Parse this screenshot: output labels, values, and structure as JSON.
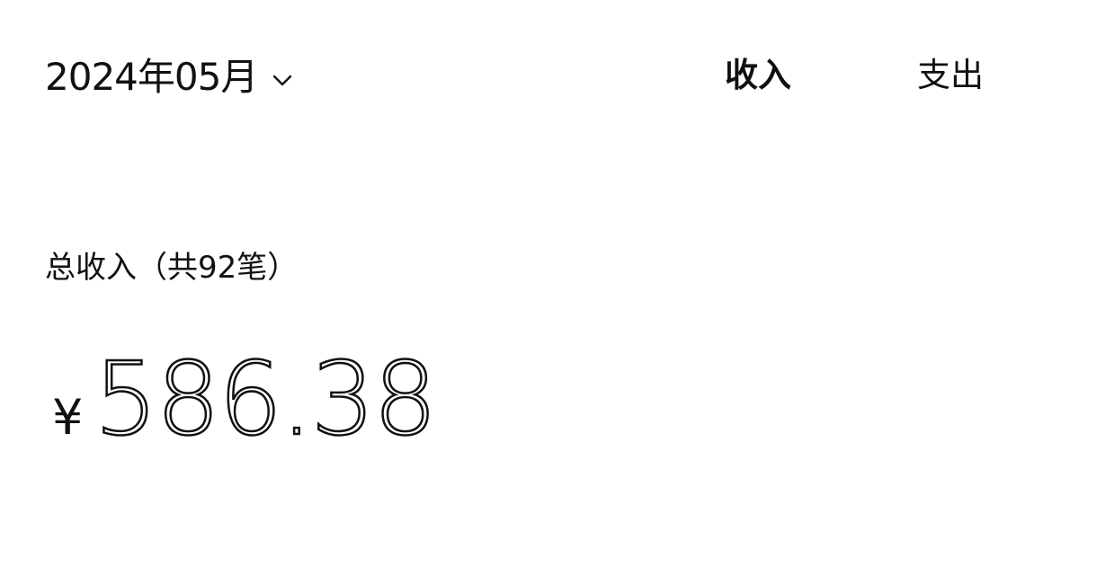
{
  "header": {
    "month_label": "2024年05月",
    "month_dropdown_icon": "chevron-down-icon",
    "tabs": [
      {
        "label": "收入",
        "active": true
      },
      {
        "label": "支出",
        "active": false
      }
    ]
  },
  "summary": {
    "label": "总收入（共92笔）",
    "currency_symbol": "¥",
    "amount": "586.38"
  },
  "colors": {
    "text": "#111111",
    "background": "#ffffff"
  }
}
